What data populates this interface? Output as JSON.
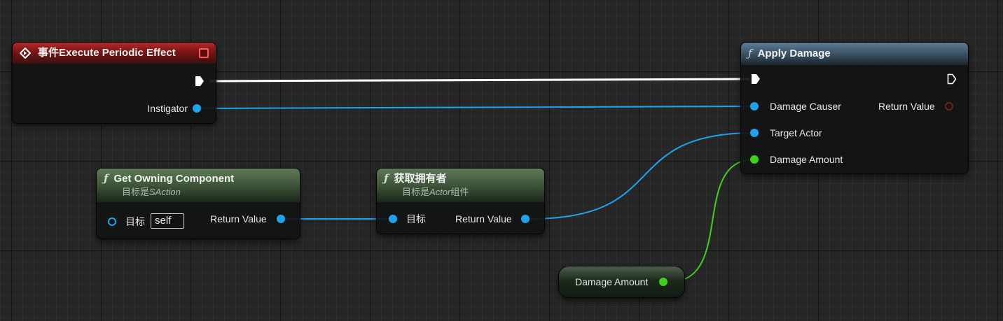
{
  "nodes": {
    "event": {
      "title": "事件Execute Periodic Effect",
      "instigator": "Instigator"
    },
    "apply_damage": {
      "fn_glyph": "ƒ",
      "title": "Apply Damage",
      "damage_causer": "Damage Causer",
      "target_actor": "Target Actor",
      "damage_amount": "Damage Amount",
      "return_value": "Return Value"
    },
    "get_owning_component": {
      "fn_glyph": "ƒ",
      "title": "Get Owning Component",
      "subtitle_prefix": "目标是",
      "subtitle_target": "SAction",
      "target_label": "目标",
      "self_value": "self",
      "return_value": "Return Value"
    },
    "get_owner": {
      "fn_glyph": "ƒ",
      "title": "获取拥有者",
      "subtitle_prefix": "目标是",
      "subtitle_target": "Actor",
      "subtitle_suffix": "组件",
      "target_label": "目标",
      "return_value": "Return Value"
    },
    "damage_amount_var": {
      "label": "Damage Amount"
    }
  },
  "colors": {
    "object_pin": "#1ea3ef",
    "float_pin": "#3ed11a",
    "exec_pin": "#ffffff",
    "event_header": "#8b1a1a",
    "function_header": "#44607a",
    "pure_header": "#4a6345"
  }
}
